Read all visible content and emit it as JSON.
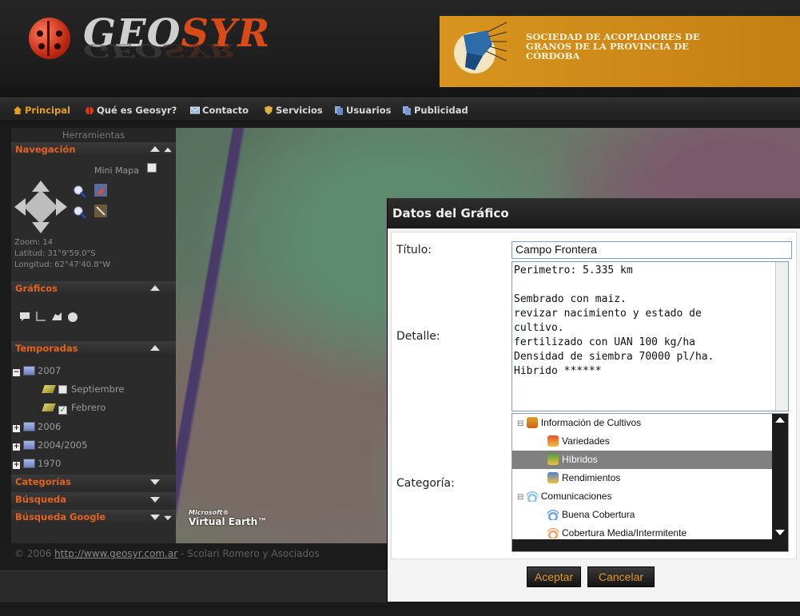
{
  "header": {
    "logo_text_main": "GEO",
    "logo_text_accent": "SYR",
    "banner_lines": [
      "SOCIEDAD DE ACOPIADORES DE",
      "GRANOS DE LA PROVINCIA DE",
      "CÓRDOBA"
    ]
  },
  "nav": {
    "items": [
      {
        "label": "Principal",
        "icon": "home-icon",
        "active": true
      },
      {
        "label": "Qué es Geosyr?",
        "icon": "ladybug-icon"
      },
      {
        "label": "Contacto",
        "icon": "mail-icon"
      },
      {
        "label": "Servicios",
        "icon": "shield-icon"
      },
      {
        "label": "Usuarios",
        "icon": "users-icon"
      },
      {
        "label": "Publicidad",
        "icon": "megaphone-icon"
      }
    ]
  },
  "tools": {
    "title": "Herramientas",
    "navegacion": {
      "label": "Navegación",
      "minimap_label": "Mini Mapa",
      "zoom": "Zoom: 14",
      "latitud": "Latitud: 31°9'59.0\"S",
      "longitud": "Longitud: 62°47'40.8\"W"
    },
    "graficos": {
      "label": "Gráficos"
    },
    "temporadas": {
      "label": "Temporadas",
      "items": [
        "2007",
        "Septiembre",
        "Febrero",
        "2006",
        "2004/2005",
        "1970"
      ]
    },
    "categorias": {
      "label": "Categorías"
    },
    "busqueda": {
      "label": "Búsqueda"
    },
    "busqueda_google": {
      "label": "Búsqueda Google"
    }
  },
  "map": {
    "brand_small": "Microsoft®",
    "brand_name": "Virtual Earth™"
  },
  "footer": {
    "prefix": "© 2006 ",
    "link": "http://www.geosyr.com.ar",
    "suffix": " - Scolari Romero y Asociados"
  },
  "dialog": {
    "title": "Datos del Gráfico",
    "titulo_label": "Título:",
    "titulo_value": "Campo Frontera",
    "detalle_label": "Detalle:",
    "detalle_value": "Perimetro: 5.335 km\n\nSembrado con maiz.\nrevizar nacimiento y estado de\ncultivo.\nfertilizado con UAN 100 kg/ha\nDensidad de siembra 70000 pl/ha.\nHibrido ******",
    "categoria_label": "Categoría:",
    "tree": [
      {
        "label": "Información de Cultivos",
        "level": 0,
        "icon": "medal-icon"
      },
      {
        "label": "Variedades",
        "level": 1,
        "icon": "medal-icon"
      },
      {
        "label": "Híbridos",
        "level": 1,
        "icon": "medal-icon",
        "selected": true
      },
      {
        "label": "Rendimientos",
        "level": 1,
        "icon": "medal-icon"
      },
      {
        "label": "Comunicaciones",
        "level": 0,
        "icon": "signal-icon"
      },
      {
        "label": "Buena Cobertura",
        "level": 1,
        "icon": "signal-icon"
      },
      {
        "label": "Cobertura Media/Intermitente",
        "level": 1,
        "icon": "signal-icon"
      }
    ],
    "accept_label": "Aceptar",
    "cancel_label": "Cancelar"
  },
  "colors": {
    "accent_orange": "#e4621e",
    "button_text": "#e09a2a",
    "banner": "#d8951e"
  }
}
